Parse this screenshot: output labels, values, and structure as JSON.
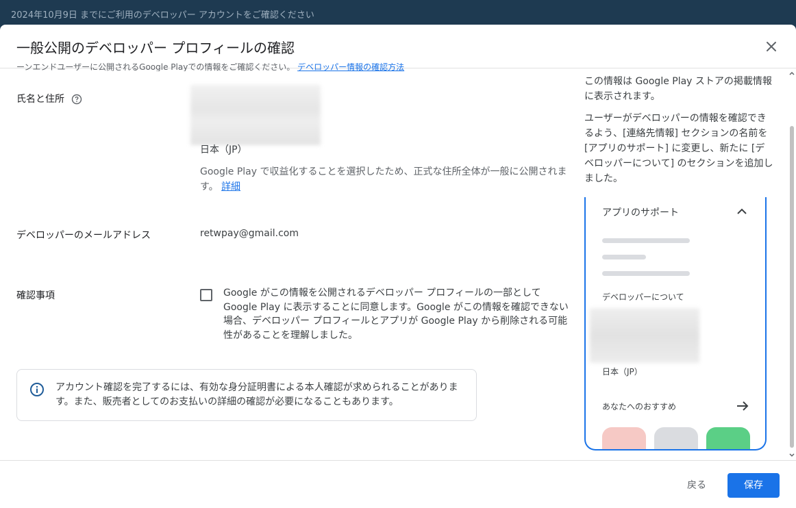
{
  "banner": {
    "text": "2024年10月9日 までにご利用のデベロッパー アカウントをご確認ください"
  },
  "dialog": {
    "title": "一般公開のデベロッパー プロフィールの確認",
    "close_icon": "close-icon"
  },
  "form": {
    "cut_text": "ーンエンドユーザーに公開されるGoogle Playでの情報をご確認ください。",
    "cut_link": "デベロッパー情報の確認方法",
    "name_address": {
      "label": "氏名と住所",
      "help_icon": "help-circle-icon",
      "country": "日本（JP）",
      "note": "Google Play で収益化することを選択したため、正式な住所全体が一般に公開されます。",
      "note_link": "詳細"
    },
    "email": {
      "label": "デベロッパーのメールアドレス",
      "value": "retwpay@gmail.com"
    },
    "confirm": {
      "label": "確認事項",
      "checked": false,
      "text": "Google がこの情報を公開されるデベロッパー プロフィールの一部として Google Play に表示することに同意します。Google がこの情報を確認できない場合、デベロッパー プロフィールとアプリが Google Play から削除される可能性があることを理解しました。"
    },
    "info": {
      "icon": "info-icon",
      "text": "アカウント確認を完了するには、有効な身分証明書による本人確認が求められることがあります。また、販売者としてのお支払いの詳細の確認が必要になることもあります。"
    }
  },
  "preview": {
    "intro1": "この情報は Google Play ストアの掲載情報に表示されます。",
    "intro2": "ユーザーがデベロッパーの情報を確認できるよう、[連絡先情報] セクションの名前を [アプリのサポート] に変更し、新たに [デベロッパーについて] のセクションを追加しました。",
    "section": "アプリのサポート",
    "chevron_icon": "chevron-up-icon",
    "about": "デベロッパーについて",
    "country": "日本（JP）",
    "recommend": "あなたへのおすすめ",
    "arrow_icon": "arrow-right-icon",
    "tile_colors": [
      "#f6c9c5",
      "#dadce0",
      "#5bcf86"
    ]
  },
  "footer": {
    "back": "戻る",
    "save": "保存"
  },
  "colors": {
    "accent": "#1a73e8",
    "banner_bg": "#1e3a51"
  }
}
